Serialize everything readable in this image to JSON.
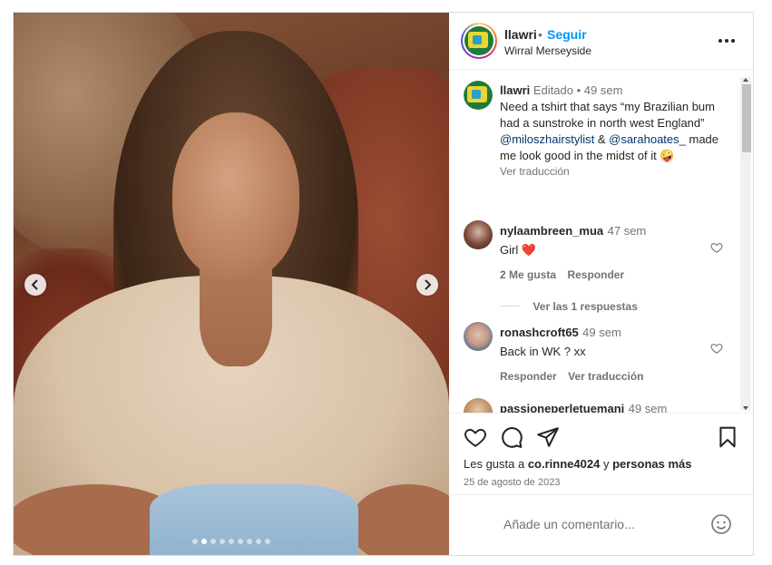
{
  "post": {
    "username": "llawri",
    "separator": "•",
    "follow_label": "Seguir",
    "location": "Wirral Merseyside",
    "more_label": "Más opciones"
  },
  "carousel": {
    "slide_count": 9,
    "active_index": 1
  },
  "caption": {
    "username": "llawri",
    "edited": "Editado",
    "dot": "•",
    "time": "49 sem",
    "text_1": "Need a tshirt that says “my Brazilian bum had a sunstroke in north west England” ",
    "mention_1": "@miloszhairstylist",
    "text_2": " & ",
    "mention_2": "@sarahoates_",
    "text_3": " made me look good in the midst of it 🤪",
    "translate": "Ver traducción"
  },
  "comments": [
    {
      "username": "nylaambreen_mua",
      "time": "47 sem",
      "text": "Girl ❤️",
      "likes": "2 Me gusta",
      "reply": "Responder",
      "view_replies": "Ver las 1 respuestas"
    },
    {
      "username": "ronashcroft65",
      "time": "49 sem",
      "text": "Back in WK ? xx",
      "reply": "Responder",
      "translate": "Ver traducción"
    },
    {
      "username": "passioneperletuemani",
      "time": "49 sem",
      "text": "🔥🔥🔥🔥❤️❤️❤️"
    }
  ],
  "actions": {
    "likes_prefix": "Les gusta a ",
    "likes_user": "co.rinne4024",
    "likes_mid": " y ",
    "likes_others": "personas más",
    "date": "25 de agosto de 2023"
  },
  "add_comment": {
    "placeholder": "Añade un comentario..."
  },
  "colors": {
    "accent": "#0095f6",
    "link": "#00376b",
    "heart_red": "#ed4956",
    "muted": "#737373",
    "border": "#dbdbdb"
  },
  "icons": [
    "chevron-left-icon",
    "chevron-right-icon",
    "more-icon",
    "heart-icon",
    "comment-icon",
    "share-icon",
    "bookmark-icon",
    "emoji-icon"
  ]
}
